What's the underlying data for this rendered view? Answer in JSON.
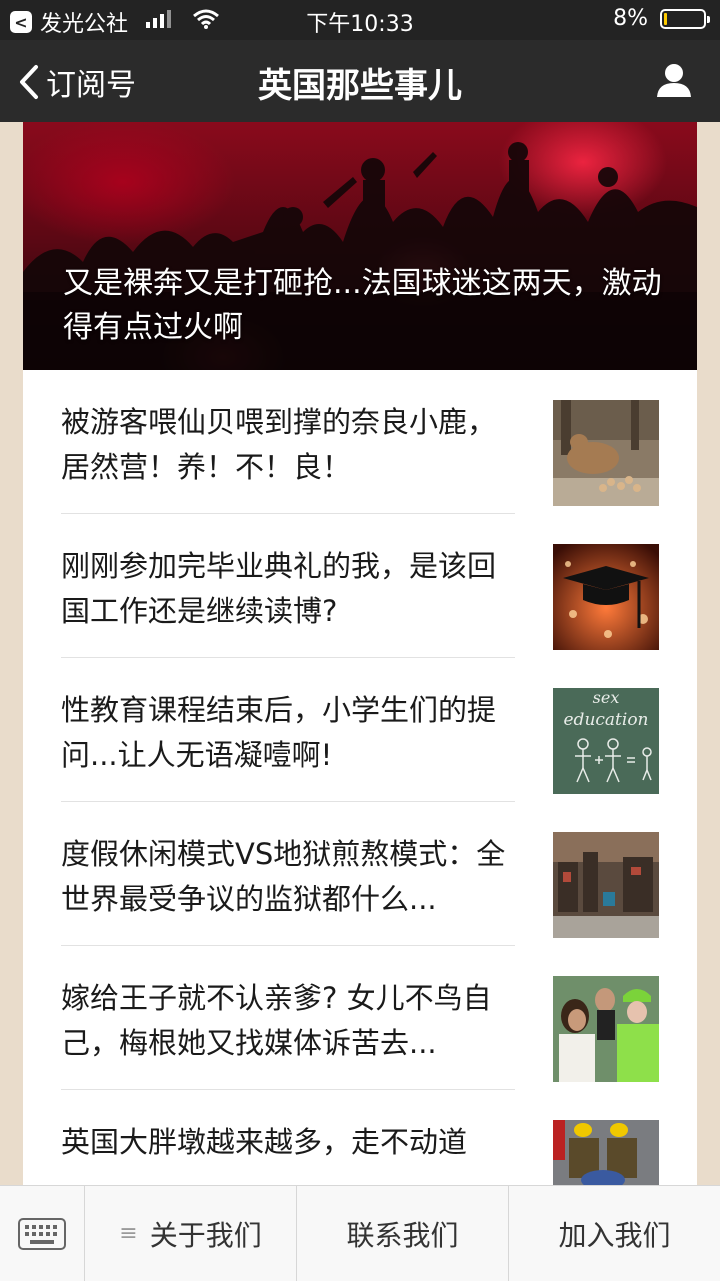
{
  "status_bar": {
    "carrier": "发光公社",
    "time": "下午10:33",
    "battery_percent": "8%",
    "battery_level": 0.08
  },
  "nav": {
    "back_label": "订阅号",
    "title": "英国那些事儿"
  },
  "hero": {
    "caption": "又是裸奔又是打砸抢...法国球迷这两天，激动得有点过火啊"
  },
  "articles": [
    {
      "title": "被游客喂仙贝喂到撑的奈良小鹿，居然营！养！不！良！"
    },
    {
      "title": "刚刚参加完毕业典礼的我，是该回国工作还是继续读博?"
    },
    {
      "title": "性教育课程结束后，小学生们的提问...让人无语凝噎啊!",
      "thumb_text": [
        "sex",
        "education"
      ]
    },
    {
      "title": "度假休闲模式VS地狱煎熬模式：全世界最受争议的监狱都什么..."
    },
    {
      "title": "嫁给王子就不认亲爹? 女儿不鸟自己，梅根她又找媒体诉苦去..."
    },
    {
      "title": "英国大胖墩越来越多，走不动道"
    }
  ],
  "bottom_menu": {
    "items": [
      "关于我们",
      "联系我们",
      "加入我们"
    ]
  },
  "colors": {
    "status_bg": "#232323",
    "nav_bg": "#2b2b2b",
    "page_bg": "#e9dccb",
    "battery_fill": "#ffcc00"
  }
}
